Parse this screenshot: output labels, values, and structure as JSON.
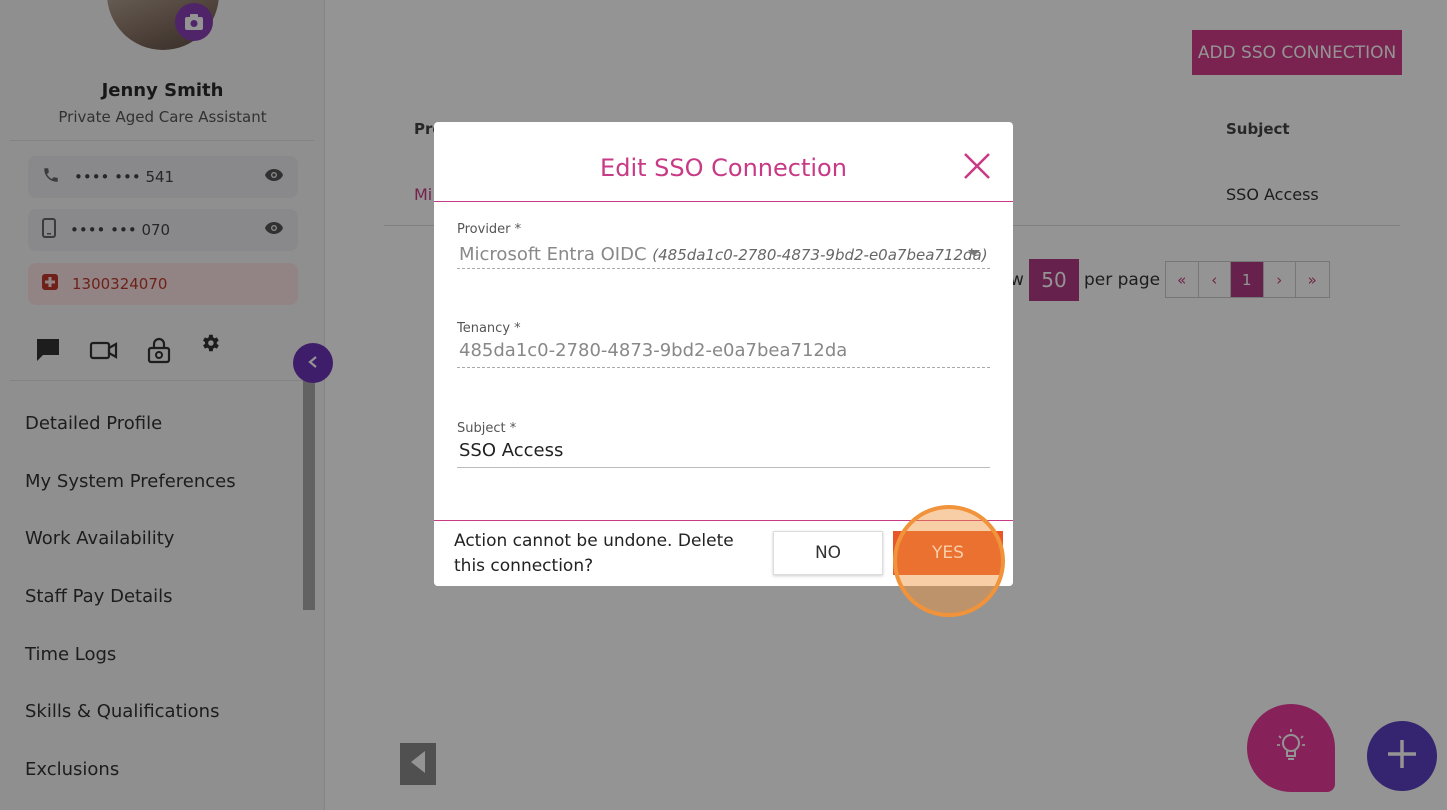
{
  "sidebar": {
    "user_name": "Jenny Smith",
    "user_role": "Private Aged Care Assistant",
    "phone": "•••• ••• 541",
    "mobile": "•••• ••• 070",
    "emergency": "1300324070",
    "menu": [
      "Detailed Profile",
      "My System Preferences",
      "Work Availability",
      "Staff Pay Details",
      "Time Logs",
      "Skills & Qualifications",
      "Exclusions"
    ]
  },
  "main": {
    "add_button": "ADD SSO CONNECTION",
    "table": {
      "col_provider": "Pro",
      "col_subject": "Subject",
      "row_provider": "Mi",
      "row_subject": "SSO Access"
    },
    "show_label": "w",
    "per_page_value": "50",
    "per_page_label": "per page",
    "pager": [
      "«",
      "‹",
      "1",
      "›",
      "»"
    ]
  },
  "modal": {
    "title": "Edit SSO Connection",
    "provider_label": "Provider *",
    "provider_value": "Microsoft Entra OIDC",
    "provider_id": "(485da1c0-2780-4873-9bd2-e0a7bea712da)",
    "tenancy_label": "Tenancy *",
    "tenancy_value": "485da1c0-2780-4873-9bd2-e0a7bea712da",
    "subject_label": "Subject *",
    "subject_value": "SSO Access",
    "confirm_message": "Action cannot be undone. Delete this connection?",
    "no_label": "NO",
    "yes_label": "YES"
  },
  "colors": {
    "accent_pink": "#c83a86",
    "brand_purple": "#6b34b8",
    "danger": "#e8562a"
  }
}
